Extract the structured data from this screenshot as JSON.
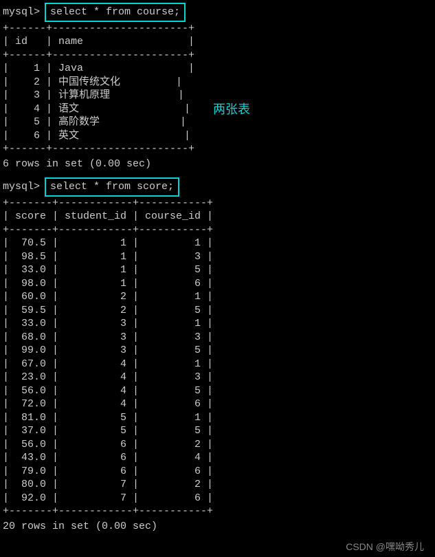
{
  "prompt": "mysql>",
  "query1": {
    "sql": "select * from course;",
    "border_top": "+------+----------------------+",
    "header": "| id   | name                 |",
    "border_mid": "+------+----------------------+",
    "rows": [
      "|    1 | Java                 |",
      "|    2 | 中国传统文化         |",
      "|    3 | 计算机原理           |",
      "|    4 | 语文                 |",
      "|    5 | 高阶数学             |",
      "|    6 | 英文                 |"
    ],
    "border_bot": "+------+----------------------+",
    "status": "6 rows in set (0.00 sec)"
  },
  "query2": {
    "sql": "select * from score;",
    "border_top": "+-------+------------+-----------+",
    "header": "| score | student_id | course_id |",
    "border_mid": "+-------+------------+-----------+",
    "rows": [
      "|  70.5 |          1 |         1 |",
      "|  98.5 |          1 |         3 |",
      "|  33.0 |          1 |         5 |",
      "|  98.0 |          1 |         6 |",
      "|  60.0 |          2 |         1 |",
      "|  59.5 |          2 |         5 |",
      "|  33.0 |          3 |         1 |",
      "|  68.0 |          3 |         3 |",
      "|  99.0 |          3 |         5 |",
      "|  67.0 |          4 |         1 |",
      "|  23.0 |          4 |         3 |",
      "|  56.0 |          4 |         5 |",
      "|  72.0 |          4 |         6 |",
      "|  81.0 |          5 |         1 |",
      "|  37.0 |          5 |         5 |",
      "|  56.0 |          6 |         2 |",
      "|  43.0 |          6 |         4 |",
      "|  79.0 |          6 |         6 |",
      "|  80.0 |          7 |         2 |",
      "|  92.0 |          7 |         6 |"
    ],
    "border_bot": "+-------+------------+-----------+",
    "status": "20 rows in set (0.00 sec)"
  },
  "annotation": "两张表",
  "watermark": "CSDN @嘿呦秀儿",
  "chart_data": [
    {
      "type": "table",
      "title": "course",
      "columns": [
        "id",
        "name"
      ],
      "rows": [
        [
          1,
          "Java"
        ],
        [
          2,
          "中国传统文化"
        ],
        [
          3,
          "计算机原理"
        ],
        [
          4,
          "语文"
        ],
        [
          5,
          "高阶数学"
        ],
        [
          6,
          "英文"
        ]
      ]
    },
    {
      "type": "table",
      "title": "score",
      "columns": [
        "score",
        "student_id",
        "course_id"
      ],
      "rows": [
        [
          70.5,
          1,
          1
        ],
        [
          98.5,
          1,
          3
        ],
        [
          33.0,
          1,
          5
        ],
        [
          98.0,
          1,
          6
        ],
        [
          60.0,
          2,
          1
        ],
        [
          59.5,
          2,
          5
        ],
        [
          33.0,
          3,
          1
        ],
        [
          68.0,
          3,
          3
        ],
        [
          99.0,
          3,
          5
        ],
        [
          67.0,
          4,
          1
        ],
        [
          23.0,
          4,
          3
        ],
        [
          56.0,
          4,
          5
        ],
        [
          72.0,
          4,
          6
        ],
        [
          81.0,
          5,
          1
        ],
        [
          37.0,
          5,
          5
        ],
        [
          56.0,
          6,
          2
        ],
        [
          43.0,
          6,
          4
        ],
        [
          79.0,
          6,
          6
        ],
        [
          80.0,
          7,
          2
        ],
        [
          92.0,
          7,
          6
        ]
      ]
    }
  ]
}
